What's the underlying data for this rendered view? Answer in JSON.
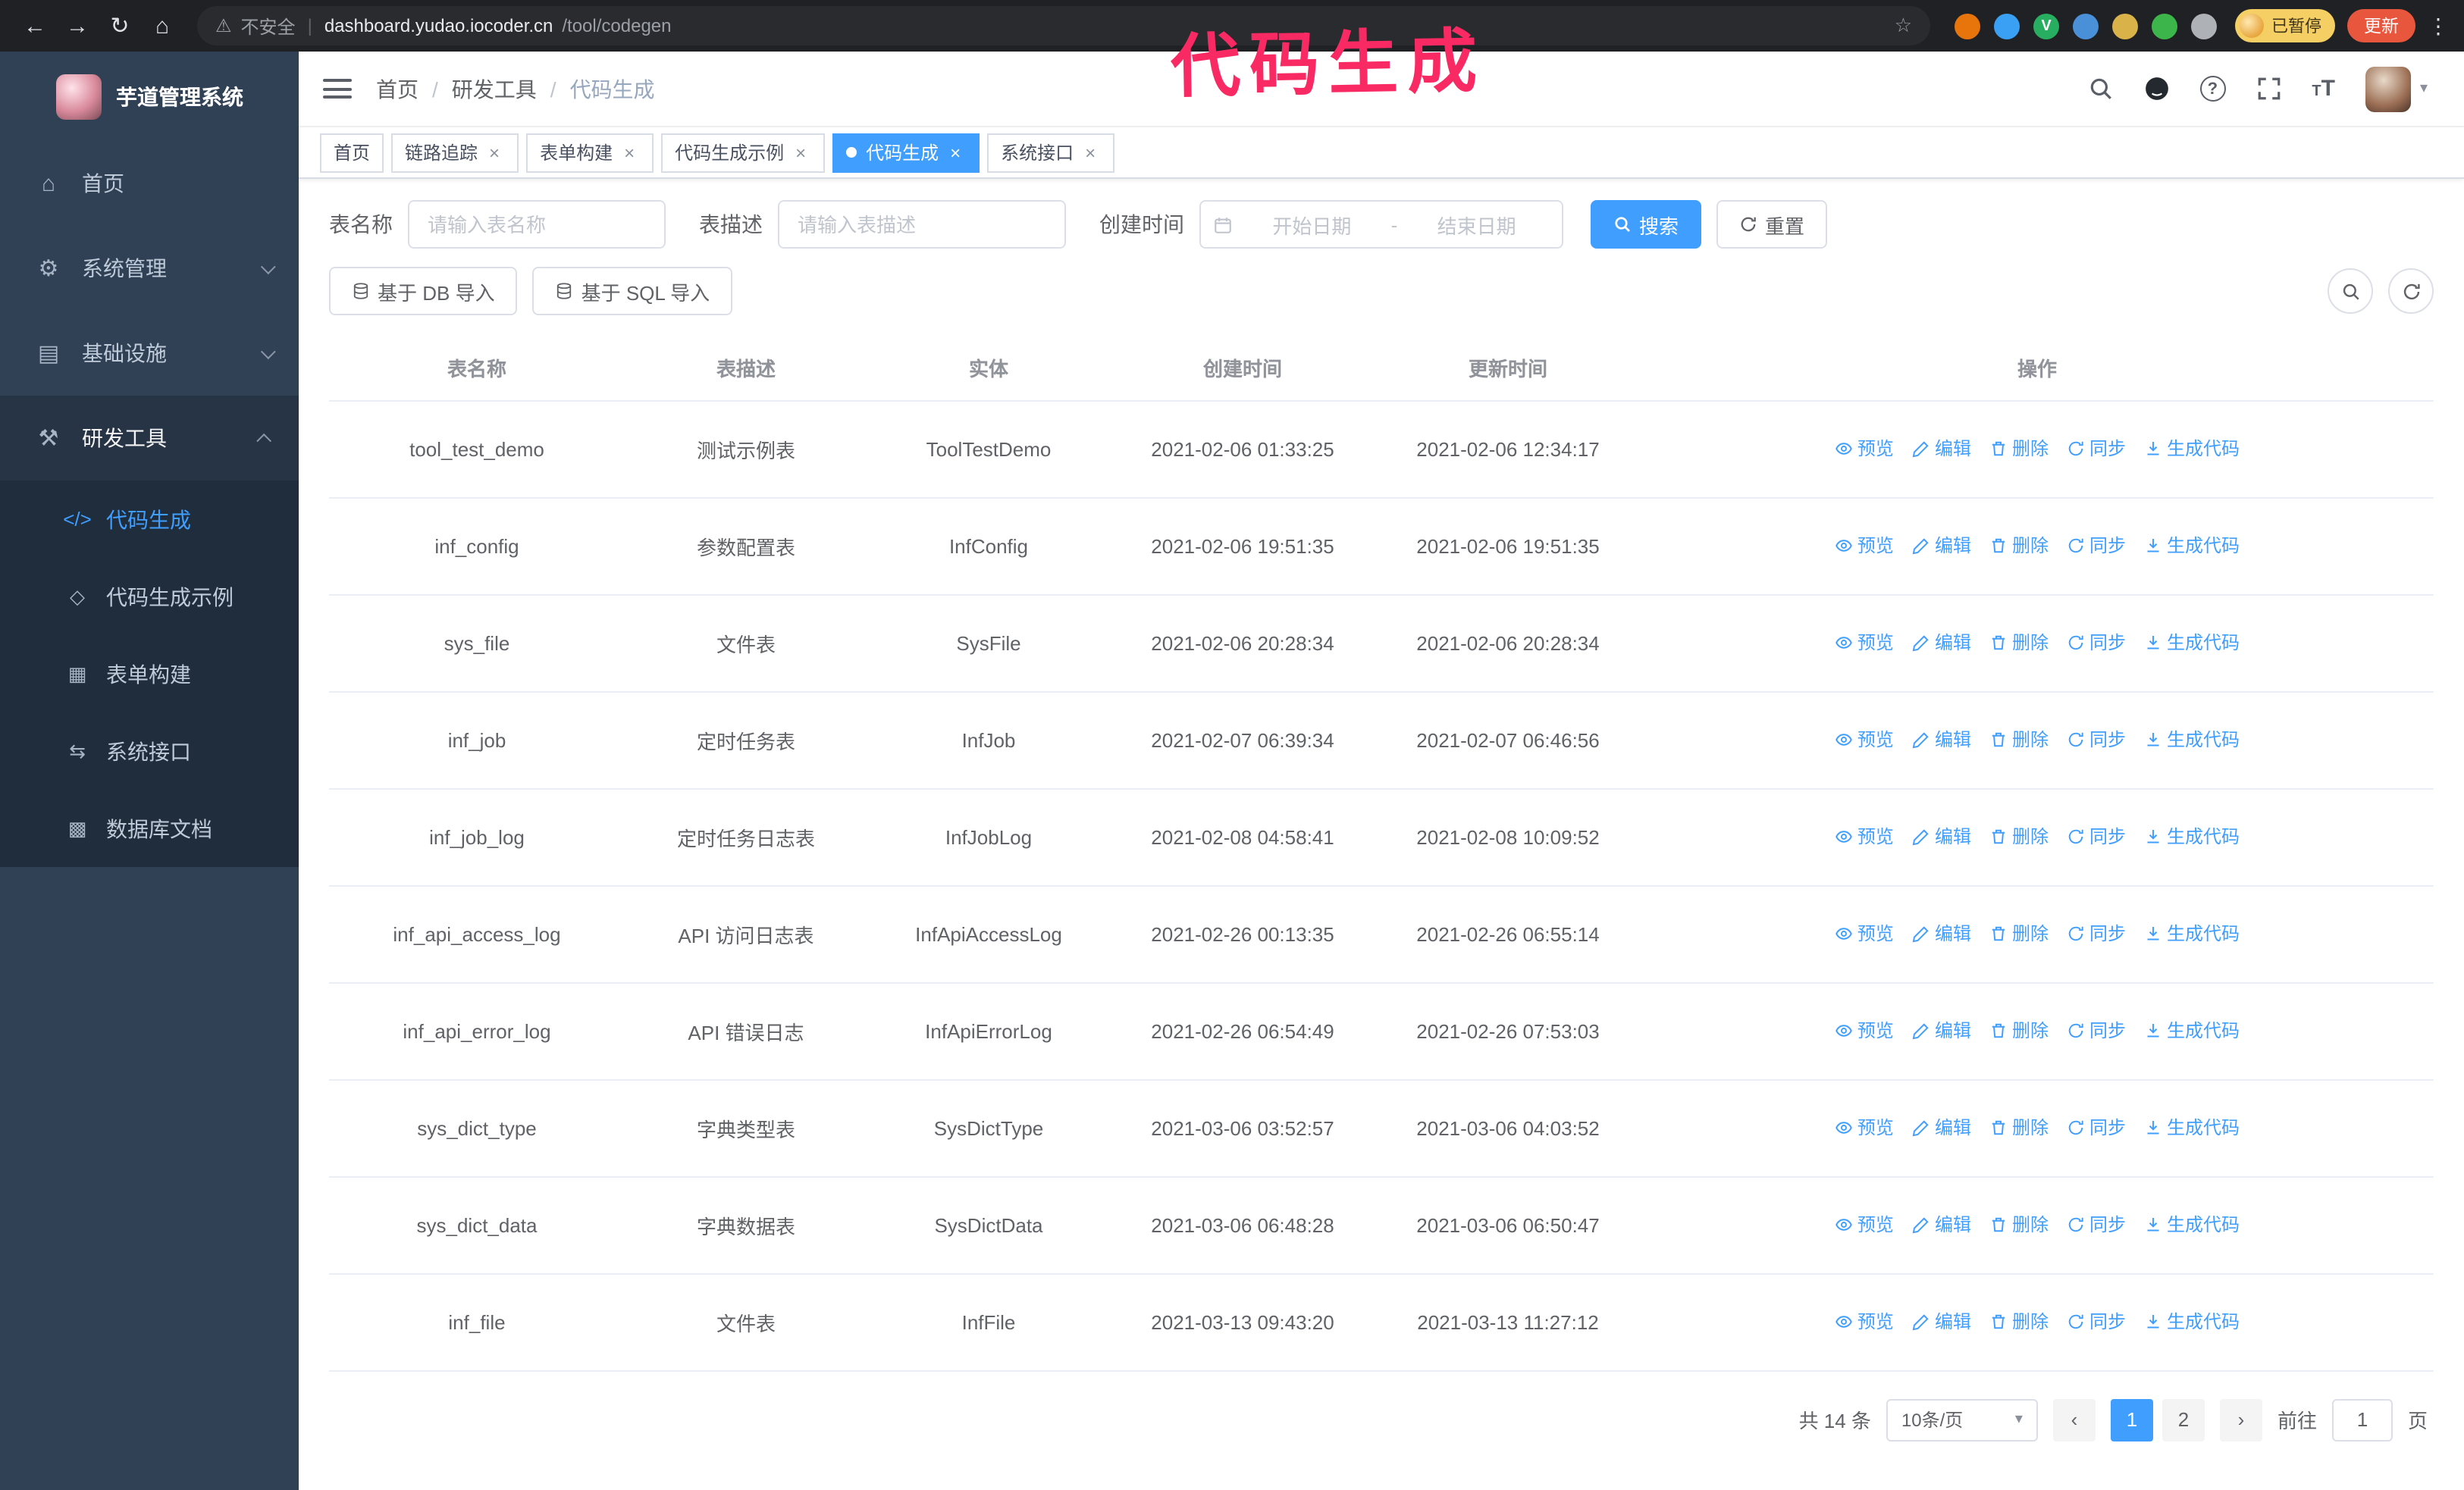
{
  "annotation": {
    "text": "代码生成",
    "color": "#f92a63"
  },
  "colors": {
    "accent": "#409eff",
    "sidebar_bg": "#304156",
    "submenu_bg": "#1f2d3d",
    "update_button": "#e8573d",
    "paused_badge": "#f5cf63"
  },
  "browser": {
    "insecure_label": "不安全",
    "url_host": "dashboard.yudao.iocoder.cn",
    "url_path": "/tool/codegen",
    "paused_badge": "已暂停",
    "update_button": "更新",
    "extension_icons": [
      {
        "name": "orange-extension-icon",
        "color": "#e8740c",
        "glyph": ""
      },
      {
        "name": "blue-drop-extension-icon",
        "color": "#3aa0f3",
        "glyph": ""
      },
      {
        "name": "green-check-extension-icon",
        "color": "#27ae60",
        "glyph": "V"
      },
      {
        "name": "people-extension-icon",
        "color": "#4a90d9",
        "glyph": ""
      },
      {
        "name": "card-extension-icon",
        "color": "#d9b24a",
        "glyph": ""
      },
      {
        "name": "leaf-extension-icon",
        "color": "#3cb54a",
        "glyph": ""
      },
      {
        "name": "puzzle-extension-icon",
        "color": "#aeb1b6",
        "glyph": ""
      }
    ]
  },
  "sidebar": {
    "logo_title": "芋道管理系统",
    "items": [
      {
        "key": "home",
        "label": "首页",
        "icon": "home-icon",
        "expandable": false,
        "expanded": false
      },
      {
        "key": "system",
        "label": "系统管理",
        "icon": "gear-icon",
        "expandable": true,
        "expanded": false
      },
      {
        "key": "infra",
        "label": "基础设施",
        "icon": "infra-icon",
        "expandable": true,
        "expanded": false
      },
      {
        "key": "devtools",
        "label": "研发工具",
        "icon": "tools-icon",
        "expandable": true,
        "expanded": true
      }
    ],
    "submenu": [
      {
        "key": "codegen",
        "label": "代码生成",
        "icon": "code-icon",
        "active": true
      },
      {
        "key": "codegen-example",
        "label": "代码生成示例",
        "icon": "shield-icon",
        "active": false
      },
      {
        "key": "form-builder",
        "label": "表单构建",
        "icon": "form-icon",
        "active": false
      },
      {
        "key": "system-api",
        "label": "系统接口",
        "icon": "api-icon",
        "active": false
      },
      {
        "key": "db-doc",
        "label": "数据库文档",
        "icon": "db-icon",
        "active": false
      }
    ]
  },
  "header": {
    "breadcrumb": [
      "首页",
      "研发工具",
      "代码生成"
    ]
  },
  "tabs": [
    {
      "key": "home",
      "label": "首页",
      "closable": false,
      "active": false
    },
    {
      "key": "trace",
      "label": "链路追踪",
      "closable": true,
      "active": false
    },
    {
      "key": "form-builder",
      "label": "表单构建",
      "closable": true,
      "active": false
    },
    {
      "key": "codegen-example",
      "label": "代码生成示例",
      "closable": true,
      "active": false
    },
    {
      "key": "codegen",
      "label": "代码生成",
      "closable": true,
      "active": true
    },
    {
      "key": "system-api",
      "label": "系统接口",
      "closable": true,
      "active": false
    }
  ],
  "filters": {
    "table_name_label": "表名称",
    "table_name_placeholder": "请输入表名称",
    "table_desc_label": "表描述",
    "table_desc_placeholder": "请输入表描述",
    "create_time_label": "创建时间",
    "date_start_placeholder": "开始日期",
    "date_separator": "-",
    "date_end_placeholder": "结束日期",
    "search_button": "搜索",
    "reset_button": "重置"
  },
  "toolbar": {
    "import_db_button": "基于 DB 导入",
    "import_sql_button": "基于 SQL 导入"
  },
  "table": {
    "columns": [
      "表名称",
      "表描述",
      "实体",
      "创建时间",
      "更新时间",
      "操作"
    ],
    "actions": [
      {
        "key": "preview",
        "label": "预览",
        "icon": "eye-icon"
      },
      {
        "key": "edit",
        "label": "编辑",
        "icon": "edit-icon"
      },
      {
        "key": "delete",
        "label": "删除",
        "icon": "delete-icon"
      },
      {
        "key": "sync",
        "label": "同步",
        "icon": "sync-icon"
      },
      {
        "key": "generate",
        "label": "生成代码",
        "icon": "download-icon"
      }
    ],
    "rows": [
      {
        "name": "tool_test_demo",
        "desc": "测试示例表",
        "entity": "ToolTestDemo",
        "created": "2021-02-06 01:33:25",
        "updated": "2021-02-06 12:34:17"
      },
      {
        "name": "inf_config",
        "desc": "参数配置表",
        "entity": "InfConfig",
        "created": "2021-02-06 19:51:35",
        "updated": "2021-02-06 19:51:35"
      },
      {
        "name": "sys_file",
        "desc": "文件表",
        "entity": "SysFile",
        "created": "2021-02-06 20:28:34",
        "updated": "2021-02-06 20:28:34"
      },
      {
        "name": "inf_job",
        "desc": "定时任务表",
        "entity": "InfJob",
        "created": "2021-02-07 06:39:34",
        "updated": "2021-02-07 06:46:56"
      },
      {
        "name": "inf_job_log",
        "desc": "定时任务日志表",
        "entity": "InfJobLog",
        "created": "2021-02-08 04:58:41",
        "updated": "2021-02-08 10:09:52"
      },
      {
        "name": "inf_api_access_log",
        "desc": "API 访问日志表",
        "entity": "InfApiAccessLog",
        "created": "2021-02-26 00:13:35",
        "updated": "2021-02-26 06:55:14"
      },
      {
        "name": "inf_api_error_log",
        "desc": "API 错误日志",
        "entity": "InfApiErrorLog",
        "created": "2021-02-26 06:54:49",
        "updated": "2021-02-26 07:53:03"
      },
      {
        "name": "sys_dict_type",
        "desc": "字典类型表",
        "entity": "SysDictType",
        "created": "2021-03-06 03:52:57",
        "updated": "2021-03-06 04:03:52"
      },
      {
        "name": "sys_dict_data",
        "desc": "字典数据表",
        "entity": "SysDictData",
        "created": "2021-03-06 06:48:28",
        "updated": "2021-03-06 06:50:47"
      },
      {
        "name": "inf_file",
        "desc": "文件表",
        "entity": "InfFile",
        "created": "2021-03-13 09:43:20",
        "updated": "2021-03-13 11:27:12"
      }
    ]
  },
  "pagination": {
    "total": "共 14 条",
    "page_size": "10条/页",
    "pages": [
      "1",
      "2"
    ],
    "active_page": "1",
    "goto_label": "前往",
    "goto_value": "1",
    "goto_suffix": "页"
  }
}
